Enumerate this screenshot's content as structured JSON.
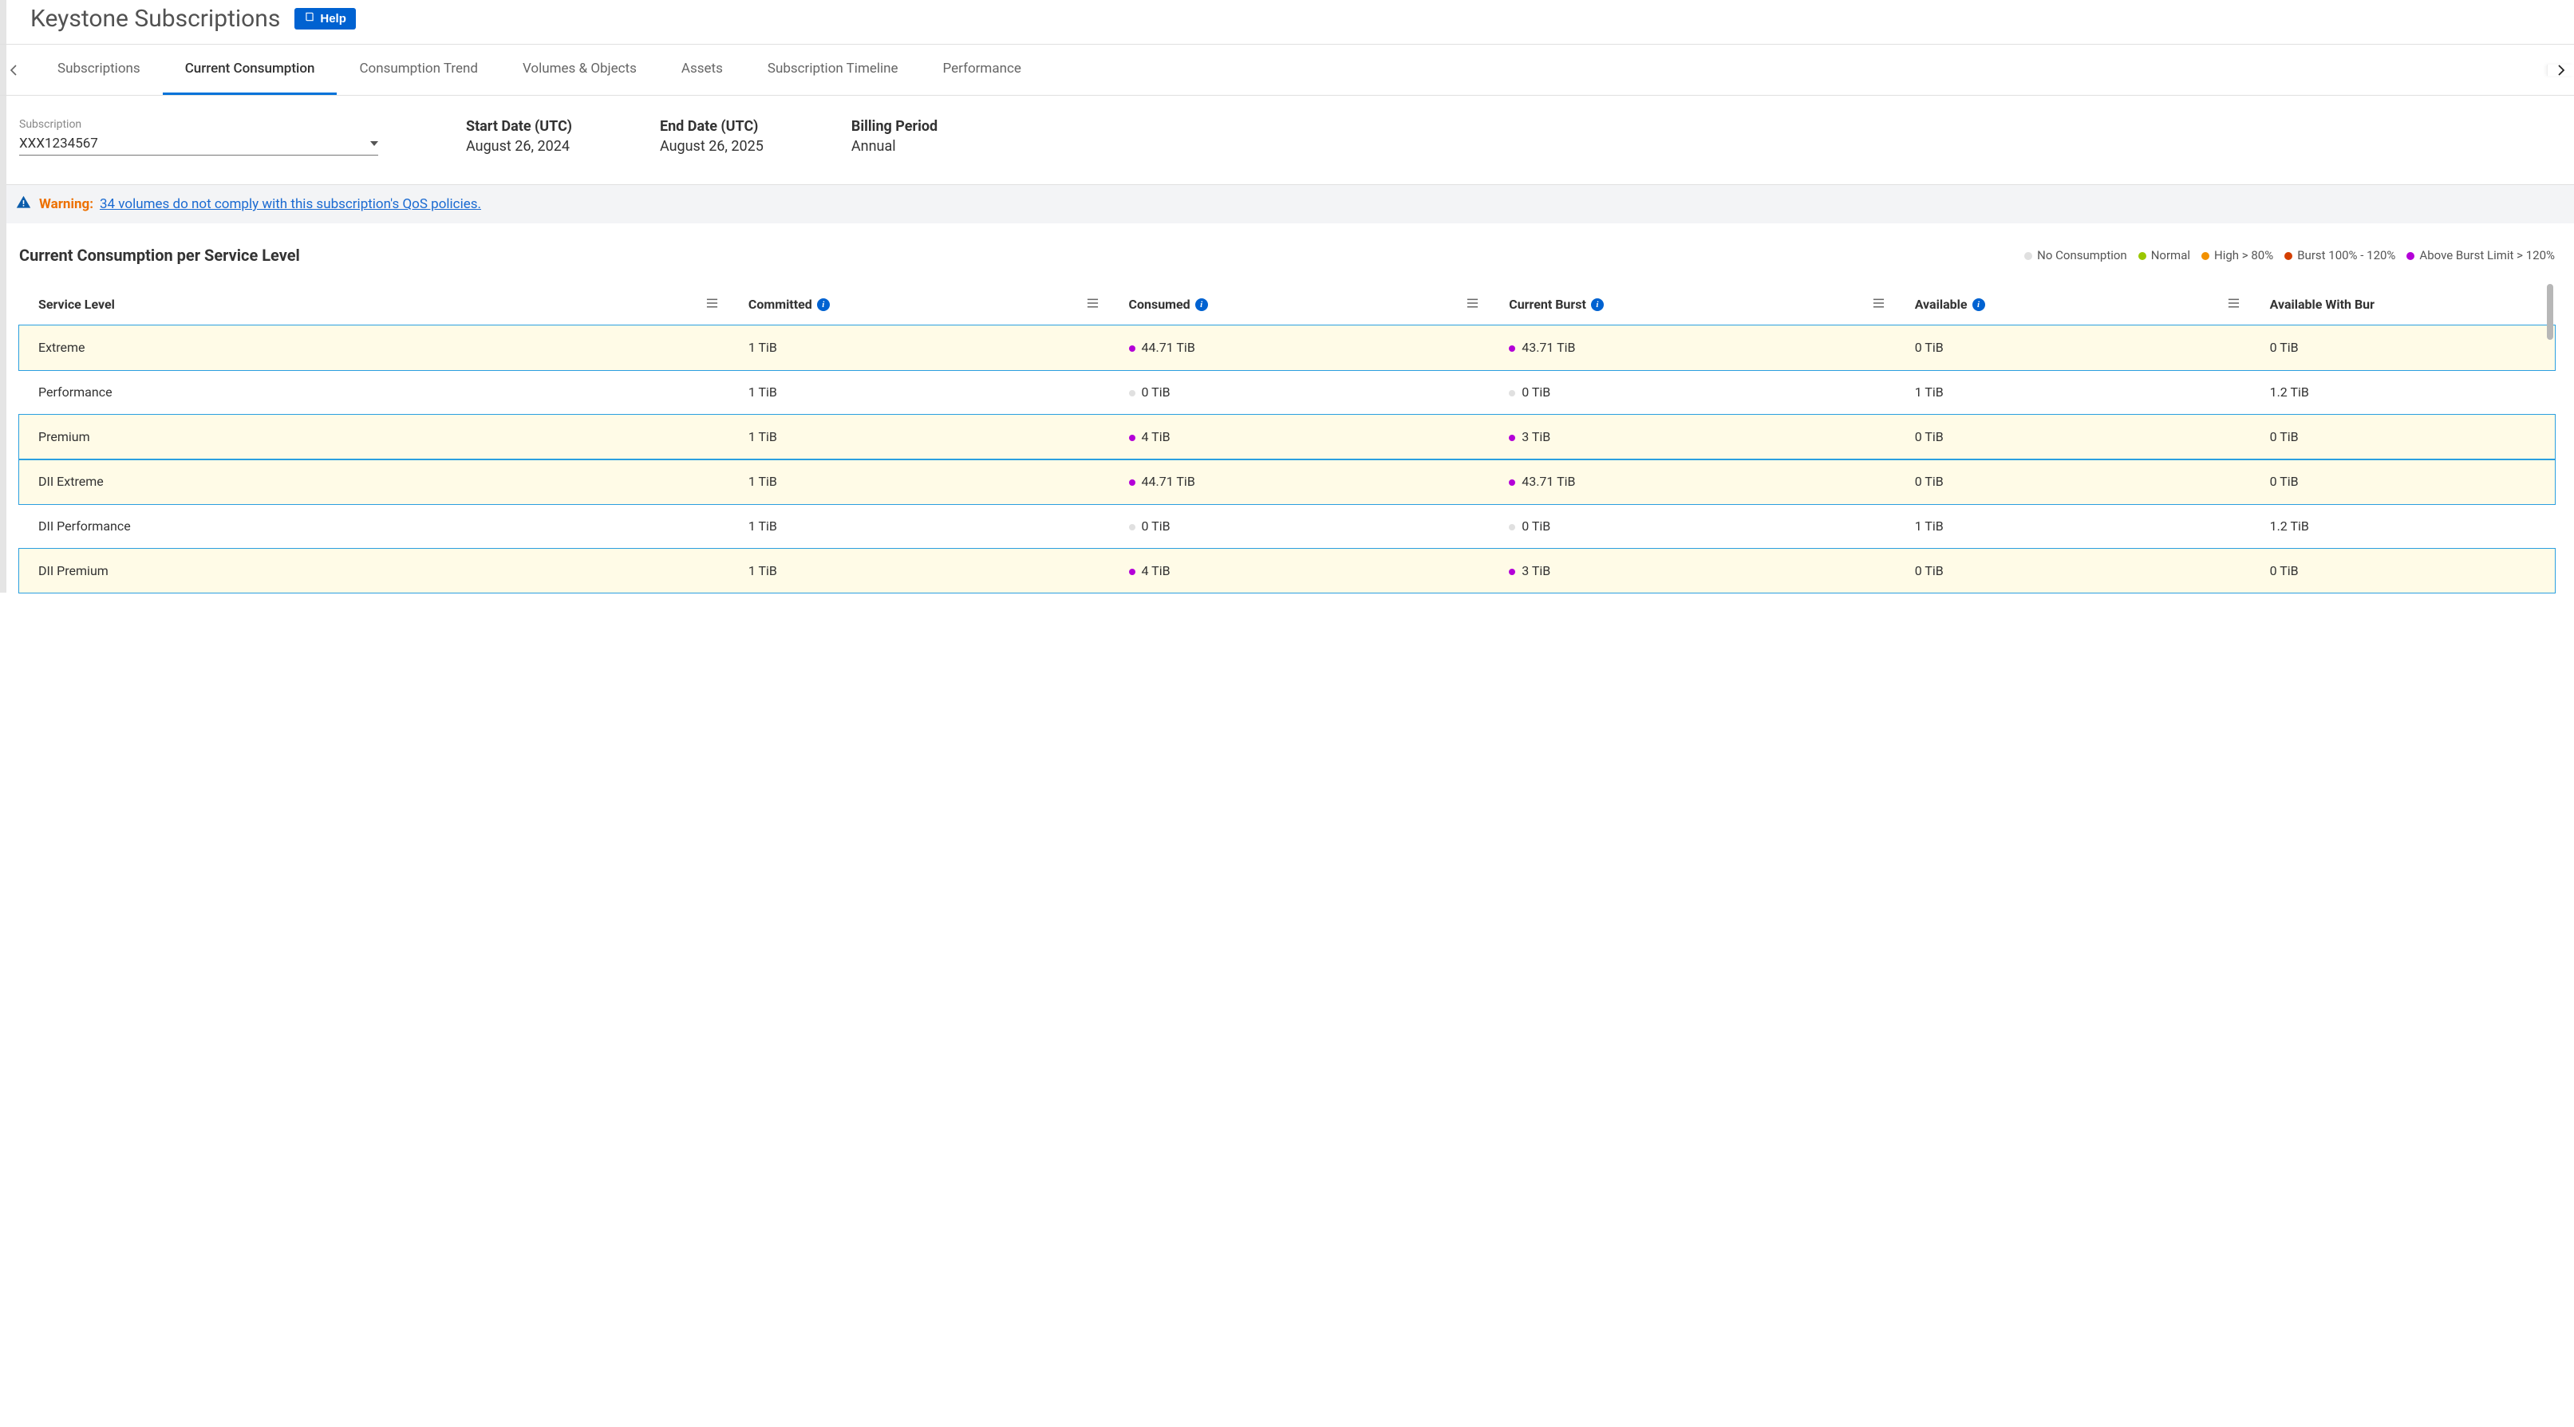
{
  "colors": {
    "none": "#e0e0e0",
    "normal": "#9ac700",
    "high": "#f29100",
    "burst": "#d43f00",
    "above": "#b400d8"
  },
  "header": {
    "title": "Keystone Subscriptions",
    "help_label": "Help"
  },
  "tabs": [
    {
      "label": "Subscriptions",
      "active": false
    },
    {
      "label": "Current Consumption",
      "active": true
    },
    {
      "label": "Consumption Trend",
      "active": false
    },
    {
      "label": "Volumes & Objects",
      "active": false
    },
    {
      "label": "Assets",
      "active": false
    },
    {
      "label": "Subscription Timeline",
      "active": false
    },
    {
      "label": "Performance",
      "active": false
    }
  ],
  "filters": {
    "subscription_label": "Subscription",
    "subscription_value": "XXX1234567",
    "start_label": "Start Date (UTC)",
    "start_value": "August 26, 2024",
    "end_label": "End Date (UTC)",
    "end_value": "August 26, 2025",
    "billing_label": "Billing Period",
    "billing_value": "Annual"
  },
  "warning": {
    "label": "Warning:",
    "link_text": "34 volumes do not comply with this subscription's QoS policies."
  },
  "panel": {
    "title": "Current Consumption per Service Level"
  },
  "legend": [
    {
      "label": "No Consumption",
      "colorKey": "none"
    },
    {
      "label": "Normal",
      "colorKey": "normal"
    },
    {
      "label": "High > 80%",
      "colorKey": "high"
    },
    {
      "label": "Burst 100% - 120%",
      "colorKey": "burst"
    },
    {
      "label": "Above Burst Limit > 120%",
      "colorKey": "above"
    }
  ],
  "columns": [
    {
      "label": "Service Level",
      "info": false
    },
    {
      "label": "Committed",
      "info": true
    },
    {
      "label": "Consumed",
      "info": true
    },
    {
      "label": "Current Burst",
      "info": true
    },
    {
      "label": "Available",
      "info": true
    },
    {
      "label": "Available With Bur",
      "info": false
    }
  ],
  "rows": [
    {
      "hl": true,
      "service": "Extreme",
      "committed": "1 TiB",
      "consumed": "44.71 TiB",
      "consumed_dot": "above",
      "burst": "43.71 TiB",
      "burst_dot": "above",
      "available": "0 TiB",
      "avail_burst": "0 TiB"
    },
    {
      "hl": false,
      "service": "Performance",
      "committed": "1 TiB",
      "consumed": "0 TiB",
      "consumed_dot": "none",
      "burst": "0 TiB",
      "burst_dot": "none",
      "available": "1 TiB",
      "avail_burst": "1.2 TiB"
    },
    {
      "hl": true,
      "service": "Premium",
      "committed": "1 TiB",
      "consumed": "4 TiB",
      "consumed_dot": "above",
      "burst": "3 TiB",
      "burst_dot": "above",
      "available": "0 TiB",
      "avail_burst": "0 TiB"
    },
    {
      "hl": true,
      "service": "DII Extreme",
      "committed": "1 TiB",
      "consumed": "44.71 TiB",
      "consumed_dot": "above",
      "burst": "43.71 TiB",
      "burst_dot": "above",
      "available": "0 TiB",
      "avail_burst": "0 TiB"
    },
    {
      "hl": false,
      "service": "DII Performance",
      "committed": "1 TiB",
      "consumed": "0 TiB",
      "consumed_dot": "none",
      "burst": "0 TiB",
      "burst_dot": "none",
      "available": "1 TiB",
      "avail_burst": "1.2 TiB"
    },
    {
      "hl": true,
      "service": "DII Premium",
      "committed": "1 TiB",
      "consumed": "4 TiB",
      "consumed_dot": "above",
      "burst": "3 TiB",
      "burst_dot": "above",
      "available": "0 TiB",
      "avail_burst": "0 TiB"
    }
  ]
}
